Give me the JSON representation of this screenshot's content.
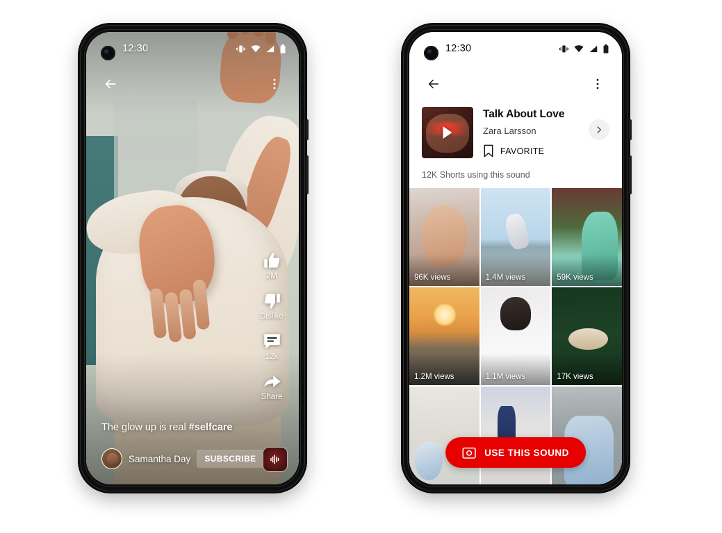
{
  "left_phone": {
    "status_bar": {
      "clock": "12:30",
      "icons": [
        "vibrate-icon",
        "wifi-icon",
        "signal-icon",
        "battery-icon"
      ]
    },
    "top_bar": {
      "back": "back-arrow-icon",
      "more": "more-vertical-icon"
    },
    "actions": [
      {
        "icon": "thumbs-up-icon",
        "label": "2M",
        "name": "like-button"
      },
      {
        "icon": "thumbs-down-icon",
        "label": "Dislike",
        "name": "dislike-button"
      },
      {
        "icon": "comment-icon",
        "label": "12k",
        "name": "comment-button"
      },
      {
        "icon": "share-icon",
        "label": "Share",
        "name": "share-button"
      }
    ],
    "caption_plain": "The glow up is real ",
    "caption_hashtag": "#selfcare",
    "channel_name": "Samantha Day",
    "subscribe_label": "SUBSCRIBE",
    "sound_chip": "sound-wave-icon"
  },
  "right_phone": {
    "status_bar": {
      "clock": "12:30",
      "icons": [
        "vibrate-icon",
        "wifi-icon",
        "signal-icon",
        "battery-icon"
      ]
    },
    "top_bar": {
      "back": "back-arrow-icon",
      "more": "more-vertical-icon"
    },
    "sound": {
      "title": "Talk About Love",
      "artist": "Zara Larsson",
      "favorite_label": "FAVORITE",
      "favorite_icon": "bookmark-icon",
      "chevron_icon": "chevron-right-icon",
      "album_play_icon": "play-icon"
    },
    "shorts_count": "12K Shorts using this sound",
    "grid": [
      {
        "views": "96K views",
        "art": "a-skincare",
        "name": "short-thumb-skincare"
      },
      {
        "views": "1.4M views",
        "art": "a-skate",
        "name": "short-thumb-skateboarder"
      },
      {
        "views": "59K views",
        "art": "a-garden",
        "name": "short-thumb-garden"
      },
      {
        "views": "1.2M views",
        "art": "a-sunset",
        "name": "short-thumb-sunset-toast"
      },
      {
        "views": "1.1M views",
        "art": "a-blanket",
        "name": "short-thumb-blanket"
      },
      {
        "views": "17K views",
        "art": "a-cake",
        "name": "short-thumb-cake"
      },
      {
        "views": "",
        "art": "a-table",
        "name": "short-thumb-table-setting"
      },
      {
        "views": "",
        "art": "a-dance",
        "name": "short-thumb-dancers"
      },
      {
        "views": "",
        "art": "a-denim",
        "name": "short-thumb-denim-man"
      }
    ],
    "use_sound": {
      "label": "USE THIS SOUND",
      "icon": "camera-icon"
    }
  },
  "colors": {
    "brand_red": "#e60000",
    "bg": "#ffffff",
    "bezel": "#0d0d0d"
  }
}
